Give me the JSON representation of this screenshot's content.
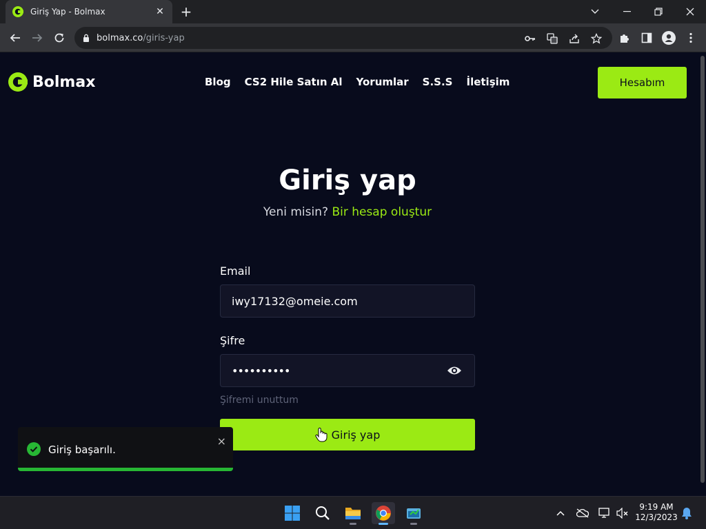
{
  "browser": {
    "tab_title": "Giriş Yap - Bolmax",
    "url_domain": "bolmax.co",
    "url_path": "/giris-yap"
  },
  "site": {
    "brand": "Bolmax",
    "brand_color": "#9bea14",
    "nav": [
      "Blog",
      "CS2 Hile Satın Al",
      "Yorumlar",
      "S.S.S",
      "İletişim"
    ],
    "account_button": "Hesabım"
  },
  "login": {
    "title": "Giriş yap",
    "new_prompt": "Yeni misin?",
    "signup_link": "Bir hesap oluştur",
    "email_label": "Email",
    "email_value": "iwy17132@omeie.com",
    "password_label": "Şifre",
    "password_value": "••••••••••",
    "forgot": "Şifremi unuttum",
    "submit": "Giriş yap"
  },
  "toast": {
    "message": "Giriş başarılı.",
    "close": "×",
    "success_color": "#27b734"
  },
  "taskbar": {
    "time": "9:19 AM",
    "date": "12/3/2023"
  }
}
